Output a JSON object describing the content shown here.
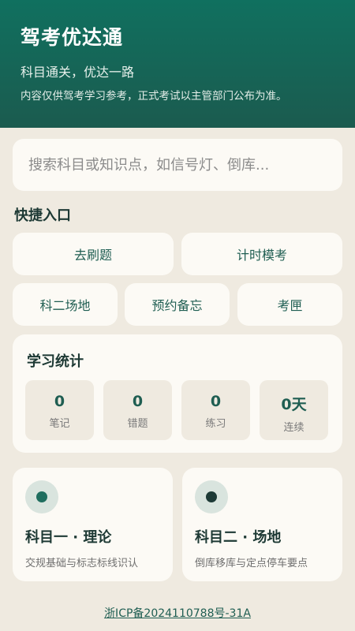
{
  "header": {
    "title": "驾考优达通",
    "slogan": "科目通关，优达一路",
    "disclaimer": "内容仅供驾考学习参考，正式考试以主管部门公布为准。"
  },
  "search": {
    "placeholder": "搜索科目或知识点，如信号灯、倒库..."
  },
  "quick_access": {
    "title": "快捷入口",
    "row1": [
      "去刷题",
      "计时模考"
    ],
    "row2": [
      "科二场地",
      "预约备忘",
      "考匣"
    ]
  },
  "stats": {
    "title": "学习统计",
    "items": [
      {
        "value": "0",
        "label": "笔记"
      },
      {
        "value": "0",
        "label": "错题"
      },
      {
        "value": "0",
        "label": "练习"
      },
      {
        "value": "0天",
        "label": "连续"
      }
    ]
  },
  "subjects": [
    {
      "title": "科目一 · 理论",
      "desc": "交规基础与标志标线识认",
      "dot_color": "#1f6e5f"
    },
    {
      "title": "科目二 · 场地",
      "desc": "倒库移库与定点停车要点",
      "dot_color": "#1d3a36"
    }
  ],
  "footer": {
    "icp": "浙ICP备2024110788号-31A"
  },
  "colors": {
    "header_gradient_top": "#10705f",
    "header_gradient_bottom": "#1b5b4f",
    "background": "#efeae0",
    "card": "#fcfaf5",
    "accent": "#1f5e52"
  }
}
